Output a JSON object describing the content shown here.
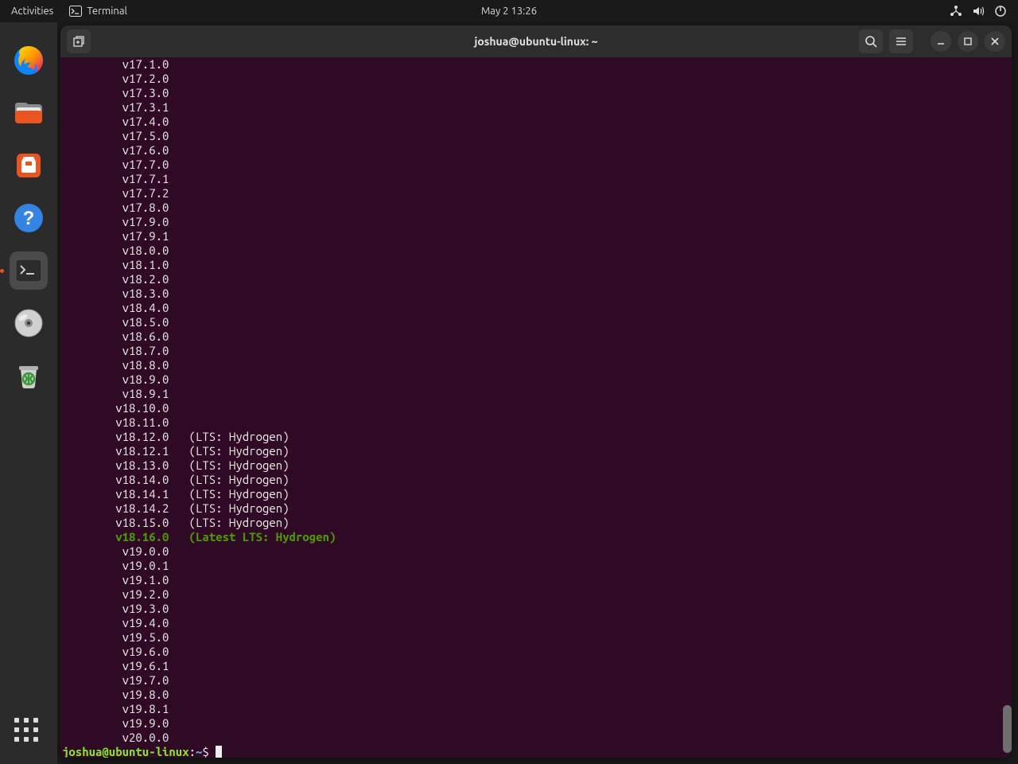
{
  "topbar": {
    "activities": "Activities",
    "appname": "Terminal",
    "datetime": "May 2  13:26"
  },
  "window": {
    "title": "joshua@ubuntu-linux: ~"
  },
  "dock": {
    "items": [
      "firefox",
      "files",
      "software",
      "help",
      "terminal",
      "disc",
      "trash"
    ]
  },
  "terminal": {
    "lines": [
      {
        "ver": "v17.1.0",
        "tag": ""
      },
      {
        "ver": "v17.2.0",
        "tag": ""
      },
      {
        "ver": "v17.3.0",
        "tag": ""
      },
      {
        "ver": "v17.3.1",
        "tag": ""
      },
      {
        "ver": "v17.4.0",
        "tag": ""
      },
      {
        "ver": "v17.5.0",
        "tag": ""
      },
      {
        "ver": "v17.6.0",
        "tag": ""
      },
      {
        "ver": "v17.7.0",
        "tag": ""
      },
      {
        "ver": "v17.7.1",
        "tag": ""
      },
      {
        "ver": "v17.7.2",
        "tag": ""
      },
      {
        "ver": "v17.8.0",
        "tag": ""
      },
      {
        "ver": "v17.9.0",
        "tag": ""
      },
      {
        "ver": "v17.9.1",
        "tag": ""
      },
      {
        "ver": "v18.0.0",
        "tag": ""
      },
      {
        "ver": "v18.1.0",
        "tag": ""
      },
      {
        "ver": "v18.2.0",
        "tag": ""
      },
      {
        "ver": "v18.3.0",
        "tag": ""
      },
      {
        "ver": "v18.4.0",
        "tag": ""
      },
      {
        "ver": "v18.5.0",
        "tag": ""
      },
      {
        "ver": "v18.6.0",
        "tag": ""
      },
      {
        "ver": "v18.7.0",
        "tag": ""
      },
      {
        "ver": "v18.8.0",
        "tag": ""
      },
      {
        "ver": "v18.9.0",
        "tag": ""
      },
      {
        "ver": "v18.9.1",
        "tag": ""
      },
      {
        "ver": "v18.10.0",
        "tag": ""
      },
      {
        "ver": "v18.11.0",
        "tag": ""
      },
      {
        "ver": "v18.12.0",
        "tag": "(LTS: Hydrogen)"
      },
      {
        "ver": "v18.12.1",
        "tag": "(LTS: Hydrogen)"
      },
      {
        "ver": "v18.13.0",
        "tag": "(LTS: Hydrogen)"
      },
      {
        "ver": "v18.14.0",
        "tag": "(LTS: Hydrogen)"
      },
      {
        "ver": "v18.14.1",
        "tag": "(LTS: Hydrogen)"
      },
      {
        "ver": "v18.14.2",
        "tag": "(LTS: Hydrogen)"
      },
      {
        "ver": "v18.15.0",
        "tag": "(LTS: Hydrogen)"
      },
      {
        "ver": "v18.16.0",
        "tag": "(Latest LTS: Hydrogen)",
        "latest": true
      },
      {
        "ver": "v19.0.0",
        "tag": ""
      },
      {
        "ver": "v19.0.1",
        "tag": ""
      },
      {
        "ver": "v19.1.0",
        "tag": ""
      },
      {
        "ver": "v19.2.0",
        "tag": ""
      },
      {
        "ver": "v19.3.0",
        "tag": ""
      },
      {
        "ver": "v19.4.0",
        "tag": ""
      },
      {
        "ver": "v19.5.0",
        "tag": ""
      },
      {
        "ver": "v19.6.0",
        "tag": ""
      },
      {
        "ver": "v19.6.1",
        "tag": ""
      },
      {
        "ver": "v19.7.0",
        "tag": ""
      },
      {
        "ver": "v19.8.0",
        "tag": ""
      },
      {
        "ver": "v19.8.1",
        "tag": ""
      },
      {
        "ver": "v19.9.0",
        "tag": ""
      },
      {
        "ver": "v20.0.0",
        "tag": ""
      }
    ],
    "prompt": {
      "user": "joshua@ubuntu-linux",
      "sep": ":",
      "path": "~",
      "sym": "$"
    }
  }
}
